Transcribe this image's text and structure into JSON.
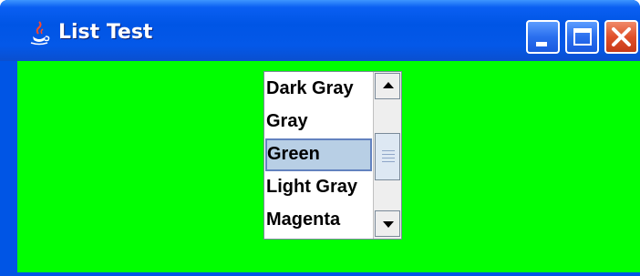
{
  "window": {
    "title": "List Test",
    "icon": "java-cup-icon",
    "controls": [
      "minimize-icon",
      "maximize-icon",
      "close-icon"
    ]
  },
  "content": {
    "background_color": "#00ff00"
  },
  "color_list": {
    "items": [
      "Dark Gray",
      "Gray",
      "Green",
      "Light Gray",
      "Magenta"
    ],
    "selected": "Green",
    "selected_index": 2
  },
  "scrollbar": {
    "up_icon": "arrow-up-icon",
    "down_icon": "arrow-down-icon"
  }
}
